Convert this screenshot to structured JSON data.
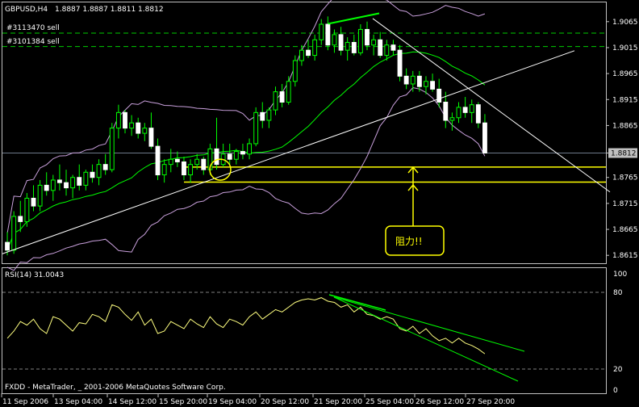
{
  "header": {
    "symbol": "GBPUSD,H4",
    "ohlc": "1.8887 1.8887 1.8811 1.8812",
    "order_1": "#3113470 sell",
    "order_2": "#3101384 sell"
  },
  "annotation": {
    "text": "阻力!!",
    "color": "#ffff00"
  },
  "indicator": {
    "label": "RSI(14) 31.0043",
    "levels": [
      "100",
      "80",
      "20",
      "0"
    ]
  },
  "footer": {
    "copyright": "FXDD - MetaTrader, _ 2001-2006 MetaQuotes Software Corp."
  },
  "colors": {
    "background": "#000000",
    "frame": "#c0c0c0",
    "bull_candle": "#ffffff",
    "bear_candle": "#ffffff",
    "bollinger": "#c9a0dc",
    "middle_band": "#00ff00",
    "rsi": "#ffff80",
    "trendline_green": "#00ff00",
    "trendline_white": "#ffffff",
    "support_yellow": "#ffff00",
    "order_lines": "#00cc00"
  },
  "chart_data": {
    "type": "candlestick",
    "price_axis": {
      "ticks": [
        "1.9065",
        "1.9015",
        "1.8965",
        "1.8915",
        "1.8865",
        "1.8812",
        "1.8765",
        "1.8715",
        "1.8665",
        "1.8615"
      ],
      "min": 1.8606,
      "max": 1.9088,
      "current": 1.8812
    },
    "time_axis": {
      "ticks": [
        "11 Sep 2006",
        "13 Sep 04:00",
        "14 Sep 12:00",
        "15 Sep 20:00",
        "19 Sep 04:00",
        "20 Sep 12:00",
        "21 Sep 20:00",
        "25 Sep 04:00",
        "26 Sep 12:00",
        "27 Sep 20:00"
      ]
    },
    "order_levels": [
      1.9043,
      1.9017
    ],
    "support_levels": [
      1.8785,
      1.8756
    ],
    "candles": [
      [
        1.864,
        1.866,
        1.8615,
        1.8625
      ],
      [
        1.8625,
        1.87,
        1.8618,
        1.869
      ],
      [
        1.869,
        1.872,
        1.866,
        1.868
      ],
      [
        1.868,
        1.8735,
        1.867,
        1.8725
      ],
      [
        1.8725,
        1.875,
        1.87,
        1.871
      ],
      [
        1.871,
        1.876,
        1.87,
        1.875
      ],
      [
        1.875,
        1.8775,
        1.873,
        1.874
      ],
      [
        1.874,
        1.877,
        1.872,
        1.876
      ],
      [
        1.876,
        1.879,
        1.874,
        1.8755
      ],
      [
        1.8755,
        1.878,
        1.873,
        1.8745
      ],
      [
        1.8745,
        1.877,
        1.8725,
        1.8765
      ],
      [
        1.8765,
        1.879,
        1.874,
        1.875
      ],
      [
        1.875,
        1.878,
        1.874,
        1.8775
      ],
      [
        1.8775,
        1.879,
        1.8755,
        1.8765
      ],
      [
        1.8765,
        1.88,
        1.875,
        1.879
      ],
      [
        1.879,
        1.881,
        1.877,
        1.878
      ],
      [
        1.878,
        1.887,
        1.8775,
        1.886
      ],
      [
        1.886,
        1.8905,
        1.884,
        1.889
      ],
      [
        1.889,
        1.8895,
        1.885,
        1.886
      ],
      [
        1.886,
        1.8885,
        1.8845,
        1.887
      ],
      [
        1.887,
        1.888,
        1.884,
        1.885
      ],
      [
        1.885,
        1.887,
        1.8835,
        1.886
      ],
      [
        1.886,
        1.889,
        1.882,
        1.8825
      ],
      [
        1.8825,
        1.884,
        1.876,
        1.877
      ],
      [
        1.877,
        1.88,
        1.8755,
        1.879
      ],
      [
        1.879,
        1.882,
        1.8775,
        1.88
      ],
      [
        1.88,
        1.8815,
        1.8785,
        1.8795
      ],
      [
        1.8795,
        1.8805,
        1.876,
        1.877
      ],
      [
        1.877,
        1.88,
        1.8755,
        1.879
      ],
      [
        1.879,
        1.881,
        1.878,
        1.88
      ],
      [
        1.88,
        1.8805,
        1.877,
        1.878
      ],
      [
        1.878,
        1.883,
        1.877,
        1.882
      ],
      [
        1.882,
        1.888,
        1.878,
        1.879
      ],
      [
        1.879,
        1.883,
        1.8785,
        1.881
      ],
      [
        1.881,
        1.883,
        1.879,
        1.88
      ],
      [
        1.88,
        1.882,
        1.879,
        1.8815
      ],
      [
        1.8815,
        1.883,
        1.88,
        1.881
      ],
      [
        1.881,
        1.884,
        1.88,
        1.883
      ],
      [
        1.883,
        1.89,
        1.8825,
        1.889
      ],
      [
        1.889,
        1.891,
        1.886,
        1.8875
      ],
      [
        1.8875,
        1.89,
        1.886,
        1.8895
      ],
      [
        1.8895,
        1.894,
        1.8885,
        1.893
      ],
      [
        1.893,
        1.8945,
        1.89,
        1.891
      ],
      [
        1.891,
        1.896,
        1.8905,
        1.895
      ],
      [
        1.895,
        1.9,
        1.894,
        1.899
      ],
      [
        1.899,
        1.902,
        1.898,
        1.901
      ],
      [
        1.901,
        1.903,
        1.8995,
        1.9
      ],
      [
        1.9,
        1.904,
        1.899,
        1.903
      ],
      [
        1.903,
        1.907,
        1.902,
        1.906
      ],
      [
        1.906,
        1.9075,
        1.901,
        1.902
      ],
      [
        1.902,
        1.905,
        1.9005,
        1.904
      ],
      [
        1.904,
        1.9055,
        1.9,
        1.901
      ],
      [
        1.901,
        1.9035,
        1.899,
        1.9025
      ],
      [
        1.9025,
        1.904,
        1.9,
        1.9005
      ],
      [
        1.9005,
        1.906,
        1.9,
        1.905
      ],
      [
        1.905,
        1.9065,
        1.901,
        1.902
      ],
      [
        1.902,
        1.904,
        1.9,
        1.903
      ],
      [
        1.903,
        1.9045,
        1.8995,
        1.9
      ],
      [
        1.9,
        1.903,
        1.899,
        1.902
      ],
      [
        1.902,
        1.903,
        1.9,
        1.901
      ],
      [
        1.901,
        1.902,
        1.895,
        1.896
      ],
      [
        1.896,
        1.8975,
        1.8935,
        1.8945
      ],
      [
        1.8945,
        1.897,
        1.893,
        1.896
      ],
      [
        1.896,
        1.897,
        1.893,
        1.894
      ],
      [
        1.894,
        1.896,
        1.8925,
        1.895
      ],
      [
        1.895,
        1.8965,
        1.893,
        1.8935
      ],
      [
        1.8935,
        1.8955,
        1.89,
        1.891
      ],
      [
        1.891,
        1.893,
        1.886,
        1.8875
      ],
      [
        1.8875,
        1.889,
        1.8855,
        1.888
      ],
      [
        1.888,
        1.891,
        1.887,
        1.89
      ],
      [
        1.89,
        1.892,
        1.888,
        1.889
      ],
      [
        1.889,
        1.8915,
        1.887,
        1.8905
      ],
      [
        1.8905,
        1.891,
        1.886,
        1.887
      ],
      [
        1.887,
        1.8887,
        1.8811,
        1.8812
      ]
    ],
    "rsi_values": [
      44,
      50,
      58,
      55,
      60,
      52,
      48,
      62,
      60,
      55,
      50,
      57,
      56,
      64,
      62,
      58,
      72,
      70,
      64,
      59,
      66,
      55,
      60,
      48,
      50,
      58,
      55,
      52,
      60,
      56,
      53,
      62,
      56,
      53,
      60,
      58,
      55,
      62,
      66,
      60,
      64,
      68,
      66,
      70,
      74,
      76,
      77,
      76,
      78,
      75,
      74,
      70,
      72,
      66,
      70,
      64,
      63,
      60,
      62,
      60,
      52,
      50,
      54,
      48,
      52,
      46,
      42,
      44,
      40,
      44,
      40,
      38,
      35,
      31
    ]
  }
}
